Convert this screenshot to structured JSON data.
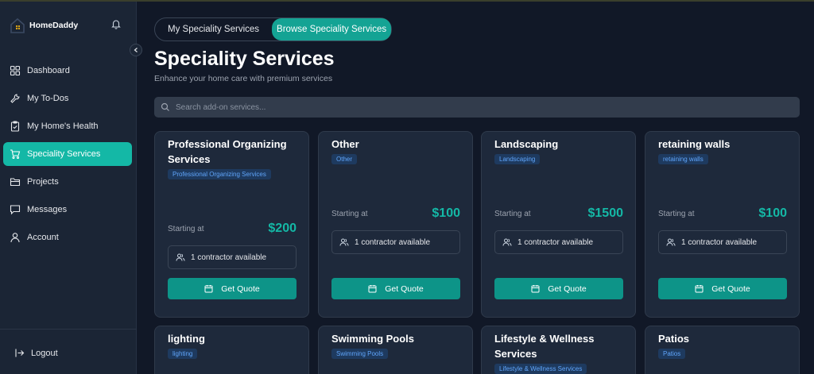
{
  "brand": {
    "name": "HomeDaddy"
  },
  "sidebar": {
    "items": [
      {
        "label": "Dashboard",
        "icon": "grid-icon",
        "active": false
      },
      {
        "label": "My To-Dos",
        "icon": "wrench-icon",
        "active": false
      },
      {
        "label": "My Home's Health",
        "icon": "clipboard-check-icon",
        "active": false
      },
      {
        "label": "Speciality Services",
        "icon": "cart-icon",
        "active": true
      },
      {
        "label": "Projects",
        "icon": "folder-icon",
        "active": false
      },
      {
        "label": "Messages",
        "icon": "message-icon",
        "active": false
      },
      {
        "label": "Account",
        "icon": "user-icon",
        "active": false
      }
    ],
    "logout_label": "Logout"
  },
  "tabs": [
    {
      "label": "My Speciality Services",
      "active": false
    },
    {
      "label": "Browse Speciality Services",
      "active": true
    }
  ],
  "page": {
    "title": "Speciality Services",
    "subtitle": "Enhance your home care with premium services"
  },
  "search": {
    "placeholder": "Search add-on services...",
    "value": ""
  },
  "cards": [
    {
      "title": "Professional Organizing Services",
      "tag": "Professional Organizing Services",
      "starting_label": "Starting at",
      "price": "$200",
      "availability": "1 contractor available",
      "button": "Get Quote"
    },
    {
      "title": "Other",
      "tag": "Other",
      "starting_label": "Starting at",
      "price": "$100",
      "availability": "1 contractor available",
      "button": "Get Quote"
    },
    {
      "title": "Landscaping",
      "tag": "Landscaping",
      "starting_label": "Starting at",
      "price": "$1500",
      "availability": "1 contractor available",
      "button": "Get Quote"
    },
    {
      "title": "retaining walls",
      "tag": "retaining walls",
      "starting_label": "Starting at",
      "price": "$100",
      "availability": "1 contractor available",
      "button": "Get Quote"
    },
    {
      "title": "lighting",
      "tag": "lighting"
    },
    {
      "title": "Swimming Pools",
      "tag": "Swimming Pools"
    },
    {
      "title": "Lifestyle & Wellness Services",
      "tag": "Lifestyle & Wellness Services"
    },
    {
      "title": "Patios",
      "tag": "Patios"
    }
  ],
  "colors": {
    "accent": "#14b8a6",
    "button": "#0d9488",
    "background": "#111827",
    "card": "#1e293b",
    "tag_text": "#60a5fa"
  }
}
